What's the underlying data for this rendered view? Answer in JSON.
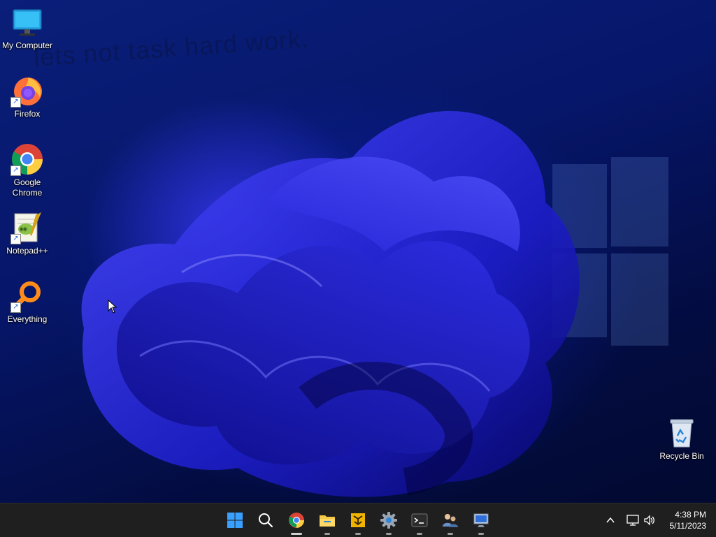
{
  "desktop": {
    "watermark_text": "lets not task hard work.",
    "icons_left": [
      {
        "name": "my-computer",
        "label": "My Computer",
        "icon": "monitor-icon"
      },
      {
        "name": "firefox",
        "label": "Firefox",
        "icon": "firefox-icon"
      },
      {
        "name": "google-chrome",
        "label": "Google Chrome",
        "icon": "chrome-icon"
      },
      {
        "name": "notepad-plus-plus",
        "label": "Notepad++",
        "icon": "notepadpp-icon"
      },
      {
        "name": "everything",
        "label": "Everything",
        "icon": "search-magnifier-icon"
      }
    ],
    "recycle_bin": {
      "label": "Recycle Bin",
      "icon": "recycle-bin-icon"
    }
  },
  "taskbar": {
    "apps": [
      {
        "name": "start",
        "icon": "windows-logo-icon"
      },
      {
        "name": "search",
        "icon": "search-icon"
      },
      {
        "name": "chrome",
        "icon": "chrome-icon",
        "running": true,
        "active": true
      },
      {
        "name": "file-explorer",
        "icon": "folder-icon",
        "running": true
      },
      {
        "name": "tool",
        "icon": "yellow-tool-icon",
        "running": true
      },
      {
        "name": "settings",
        "icon": "gear-icon",
        "running": true
      },
      {
        "name": "terminal",
        "icon": "terminal-icon",
        "running": true
      },
      {
        "name": "users",
        "icon": "users-icon",
        "running": true
      },
      {
        "name": "remote-desktop",
        "icon": "remote-desktop-icon",
        "running": true
      }
    ],
    "tray": {
      "icons": [
        "chevron-up-icon",
        "network-icon",
        "volume-icon"
      ],
      "time": "4:38 PM",
      "date": "5/11/2023"
    }
  },
  "colors": {
    "taskbar_bg": "#1f1f1f",
    "wallpaper_accent": "#2a2af0"
  }
}
